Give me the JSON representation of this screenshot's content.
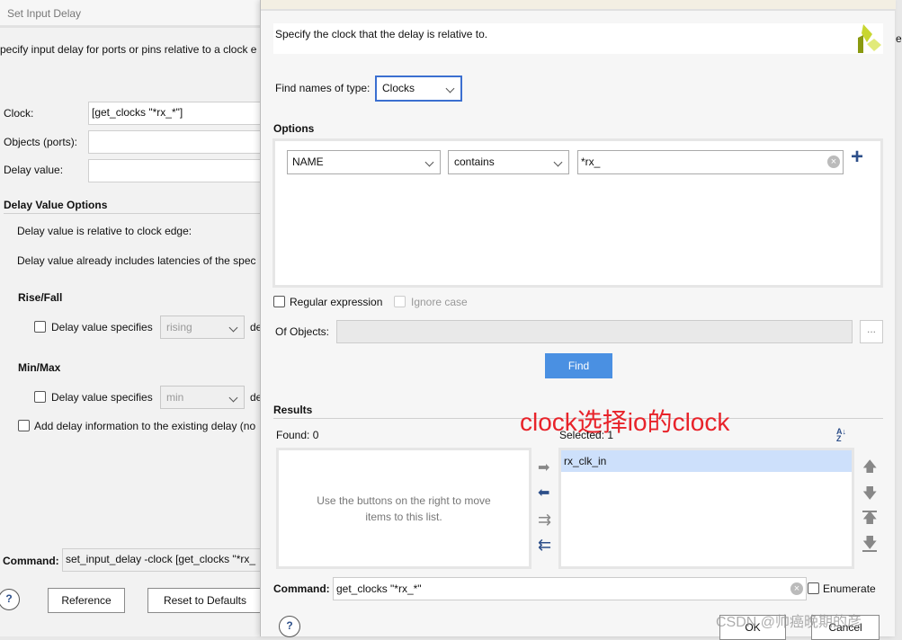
{
  "left_dialog": {
    "title": "Set Input Delay",
    "description": "pecify input delay for ports or pins relative to a clock e",
    "clock_label": "Clock:",
    "clock_value": "[get_clocks  \"*rx_*\"]",
    "objects_label": "Objects (ports):",
    "objects_value": "",
    "delay_label": "Delay value:",
    "delay_value": "",
    "options_header": "Delay Value Options",
    "relative_text": "Delay value is relative to clock edge:",
    "latency_text": "Delay value already includes latencies of the spec",
    "risefall_header": "Rise/Fall",
    "rise_checkbox_label": "Delay value specifies",
    "rise_select": "rising",
    "rise_suffix": "de",
    "minmax_header": "Min/Max",
    "min_checkbox_label": "Delay value specifies",
    "min_select": "min",
    "min_suffix": "de",
    "add_delay_label": "Add delay information to the existing delay (no",
    "command_label": "Command:",
    "command_value": "set_input_delay -clock [get_clocks  \"*rx_",
    "help": "?",
    "reference_button": "Reference",
    "reset_button": "Reset to Defaults"
  },
  "right_dialog": {
    "description": "Specify the clock that the delay is relative to.",
    "find_type_label": "Find names of type:",
    "find_type_value": "Clocks",
    "options_header": "Options",
    "filter_field": "NAME",
    "filter_op": "contains",
    "filter_value": "*rx_",
    "regex_label": "Regular expression",
    "ignore_case_label": "Ignore case",
    "of_objects_label": "Of Objects:",
    "of_objects_value": "",
    "more_button": "...",
    "find_button": "Find",
    "results_header": "Results",
    "found_label": "Found: 0",
    "found_empty_text": "Use the buttons on the right to move items to this list.",
    "selected_label": "Selected: 1",
    "selected_items": [
      "rx_clk_in"
    ],
    "command_label": "Command:",
    "command_value": "get_clocks  \"*rx_*\"",
    "enumerate_label": "Enumerate",
    "help": "?",
    "ok_button": "OK",
    "cancel_button": "Cancel",
    "accent": "#3b6fd0",
    "find_button_color": "#4a90e2"
  },
  "annotation": "clock选择io的clock",
  "watermark": "CSDN @帅癌晚期的彦",
  "background_fragment": "e"
}
